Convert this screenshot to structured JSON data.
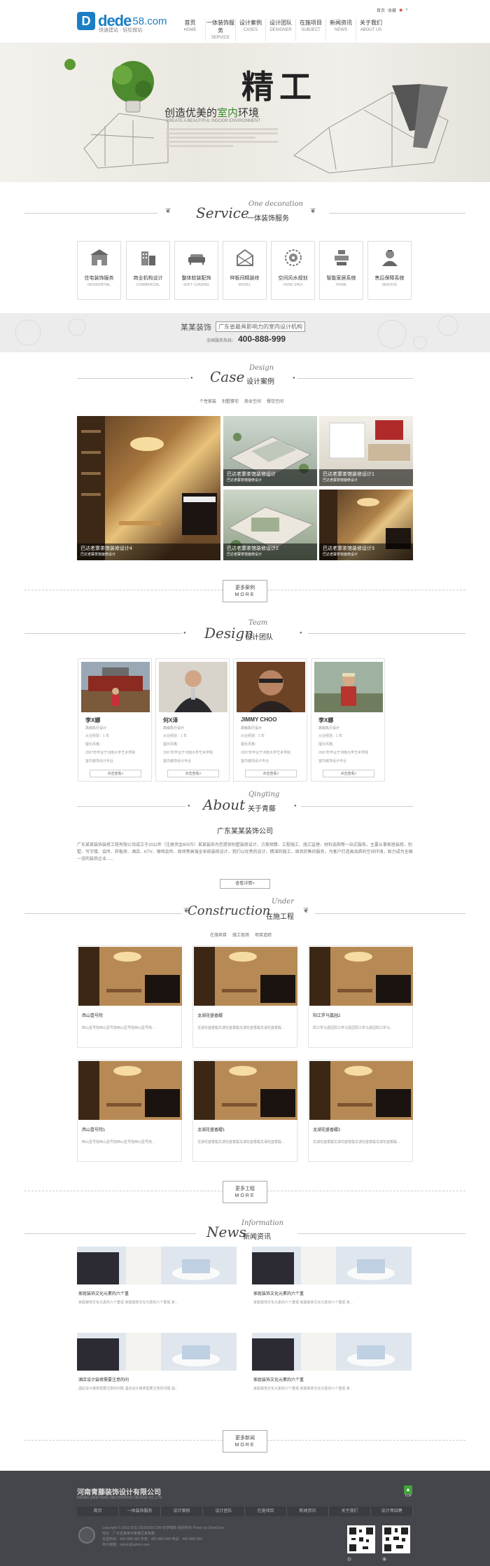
{
  "header": {
    "logo_main": "dede",
    "logo_suffix": "58.com",
    "slogan": "快速建站 · 轻松做站",
    "topbar": [
      "首页",
      "收藏"
    ],
    "nav": [
      {
        "cn": "首页",
        "en": "HOME"
      },
      {
        "cn": "一体装饰服务",
        "en": "SERVICE"
      },
      {
        "cn": "设计案例",
        "en": "CASES"
      },
      {
        "cn": "设计团队",
        "en": "DESIGNER"
      },
      {
        "cn": "在施项目",
        "en": "SUBJECT"
      },
      {
        "cn": "新闻资讯",
        "en": "NEWS"
      },
      {
        "cn": "关于我们",
        "en": "ABOUT US"
      }
    ]
  },
  "banner": {
    "title_a": "创造优美的",
    "title_b": "室内",
    "title_c": "环境",
    "subtitle": "CREATE A BEAUTIFUL INDOOR ENVIRONMENT",
    "big_char": "精工"
  },
  "service": {
    "script": "Service",
    "small": "One decoration",
    "cn": "一体装饰服务",
    "items": [
      {
        "cn": "住宅装饰服务",
        "en": "RESIDENTIAL",
        "icon": "house-icon"
      },
      {
        "cn": "商业机构设计",
        "en": "COMMERCIAL",
        "icon": "building-icon"
      },
      {
        "cn": "整体软装配饰",
        "en": "SOFT LOADING",
        "icon": "sofa-icon"
      },
      {
        "cn": "样板间精装修",
        "en": "MODEL",
        "icon": "model-house-icon"
      },
      {
        "cn": "空间风水规划",
        "en": "FENG SHUI",
        "icon": "compass-icon"
      },
      {
        "cn": "智能家居系统",
        "en": "HOME",
        "icon": "smart-home-icon"
      },
      {
        "cn": "售后保障系统",
        "en": "SERVICE",
        "icon": "support-person-icon"
      }
    ]
  },
  "hotline": {
    "company": "某某装饰",
    "tag": "广东省最具影响力的室内设计机构",
    "label": "全国服务热线：",
    "number": "400-888-999"
  },
  "cases": {
    "script": "Case",
    "small": "Design",
    "cn": "设计案例",
    "filters": [
      "个性家装",
      "别墅豪宅",
      "商业空间",
      "餐饮空间"
    ],
    "items": [
      {
        "title": "巴达老寨茶馆装修设计4",
        "sub": "巴达老寨茶馆装修设计"
      },
      {
        "title": "巴达老寨茶馆装修设计",
        "sub": "巴达老寨茶馆装修设计"
      },
      {
        "title": "巴达老寨茶馆装修设计1",
        "sub": "巴达老寨茶馆装修设计"
      },
      {
        "title": "巴达老寨茶馆装修设计2",
        "sub": "巴达老寨茶馆装修设计"
      },
      {
        "title": "巴达老寨茶馆装修设计3",
        "sub": "巴达老寨茶馆装修设计"
      }
    ],
    "more_cn": "更多案例",
    "more_en": "MORE"
  },
  "team": {
    "script": "Design",
    "small": "Team",
    "cn": "设计团队",
    "members": [
      {
        "name": "李X娜",
        "role": "高级执行设计",
        "d1": "从业经验：1 年",
        "d2": "擅长风格：",
        "d3": "2007年毕业于河南大学艺术学院",
        "d4": "室内装饰设计专业",
        "btn": "点击查看>"
      },
      {
        "name": "何X泽",
        "role": "高级执行设计",
        "d1": "从业经验：1 年",
        "d2": "擅长风格：",
        "d3": "2007年毕业于河南大学艺术学院",
        "d4": "室内装饰设计专业",
        "btn": "点击查看>"
      },
      {
        "name": "JIMMY CHOO",
        "role": "高级执行设计",
        "d1": "从业经验：1 年",
        "d2": "擅长风格：",
        "d3": "2007年毕业于河南大学艺术学院",
        "d4": "室内装饰设计专业",
        "btn": "点击查看>"
      },
      {
        "name": "李X娜",
        "role": "高级执行设计",
        "d1": "从业经验：1 年",
        "d2": "擅长风格：",
        "d3": "2007年毕业于河南大学艺术学院",
        "d4": "室内装饰设计专业",
        "btn": "点击查看>"
      }
    ]
  },
  "about": {
    "script": "About",
    "small": "Qingting",
    "cn": "关于青藤",
    "company": "广东某某装饰公司",
    "text": "广东某某装饰装修工程有限公司成立于2011年（注册资金600万）某某装饰为您提供别墅装修设计、方案预算、工程施工、施工监理、材料选购等一站式服务。主要从事家居装修、别墅、写字楼、会所、样板房、酒店、KTV、咖啡会所、商场等高端全系统装修设计，我们以优秀的设计、精湛的施工、周到的售后服务，为客户打造高品质的空间环境，致力成为全国一流的装饰企业......",
    "btn": "查看详情>"
  },
  "construction": {
    "script": "Construction",
    "small": "Under",
    "cn": "在施工程",
    "filters": [
      "在施项目",
      "施工现场",
      "项目追踪"
    ],
    "items": [
      {
        "title": "西山壹号院",
        "sub": "西山壹号院西山壹号院西山壹号院西山壹号院..."
      },
      {
        "title": "龙湖花盛香醍",
        "sub": "龙湖花盛香醍龙湖花盛香醍龙湖花盛香醍龙湖花盛香醍..."
      },
      {
        "title": "阳江罗马嘉园2",
        "sub": "阳江罗马嘉园阳江罗马嘉园阳江罗马嘉园阳江罗马..."
      },
      {
        "title": "西山壹号院1",
        "sub": "西山壹号院西山壹号院西山壹号院西山壹号院..."
      },
      {
        "title": "龙湖花盛香醍1",
        "sub": "龙湖花盛香醍龙湖花盛香醍龙湖花盛香醍龙湖花盛香醍..."
      },
      {
        "title": "龙湖花盛香醍2",
        "sub": "龙湖花盛香醍龙湖花盛香醍龙湖花盛香醍龙湖花盛香醍..."
      }
    ],
    "more_cn": "更多工程",
    "more_en": "MORE"
  },
  "news": {
    "script": "News",
    "small": "Information",
    "cn": "新闻资讯",
    "items": [
      {
        "title": "家庭装饰文化元素的六个重",
        "sub": "家庭装饰文化元素的六个重视 家庭装饰文化元素的六个重视 家..."
      },
      {
        "title": "家庭装饰文化元素的六个重",
        "sub": "家庭装饰文化元素的六个重视 家庭装饰文化元素的六个重视 家..."
      },
      {
        "title": "酒店设计装修需要注意的问",
        "sub": "酒店设计装修需要注意的问题 酒店设计装修需要注意的问题 酒..."
      },
      {
        "title": "家庭装饰文化元素的六个重",
        "sub": "家庭装饰文化元素的六个重视 家庭装饰文化元素的六个重视 家..."
      }
    ],
    "more_cn": "更多新闻",
    "more_en": "MORE"
  },
  "footer": {
    "company": "河南青藤装饰设计有限公司",
    "company_en": "HENAN QINGTENG DECORATION DESIGN CO.,LTD.",
    "top": "TOP",
    "nav": [
      "首页",
      "一体装饰服务",
      "设计案例",
      "设计团队",
      "在施项目",
      "新闻资讯",
      "关于我们",
      "设计师招聘"
    ],
    "copyright": "Copyright © 2002-2011 DEDE58.COM 织梦模板 版权所有 Power by DedeCms",
    "address": "地址：广东省某某市某某区某某路",
    "phone": "全国热线：400-888-999  传真：400-888-999  电话：400-888-999",
    "email": "电子邮箱：admin@admin.com"
  }
}
